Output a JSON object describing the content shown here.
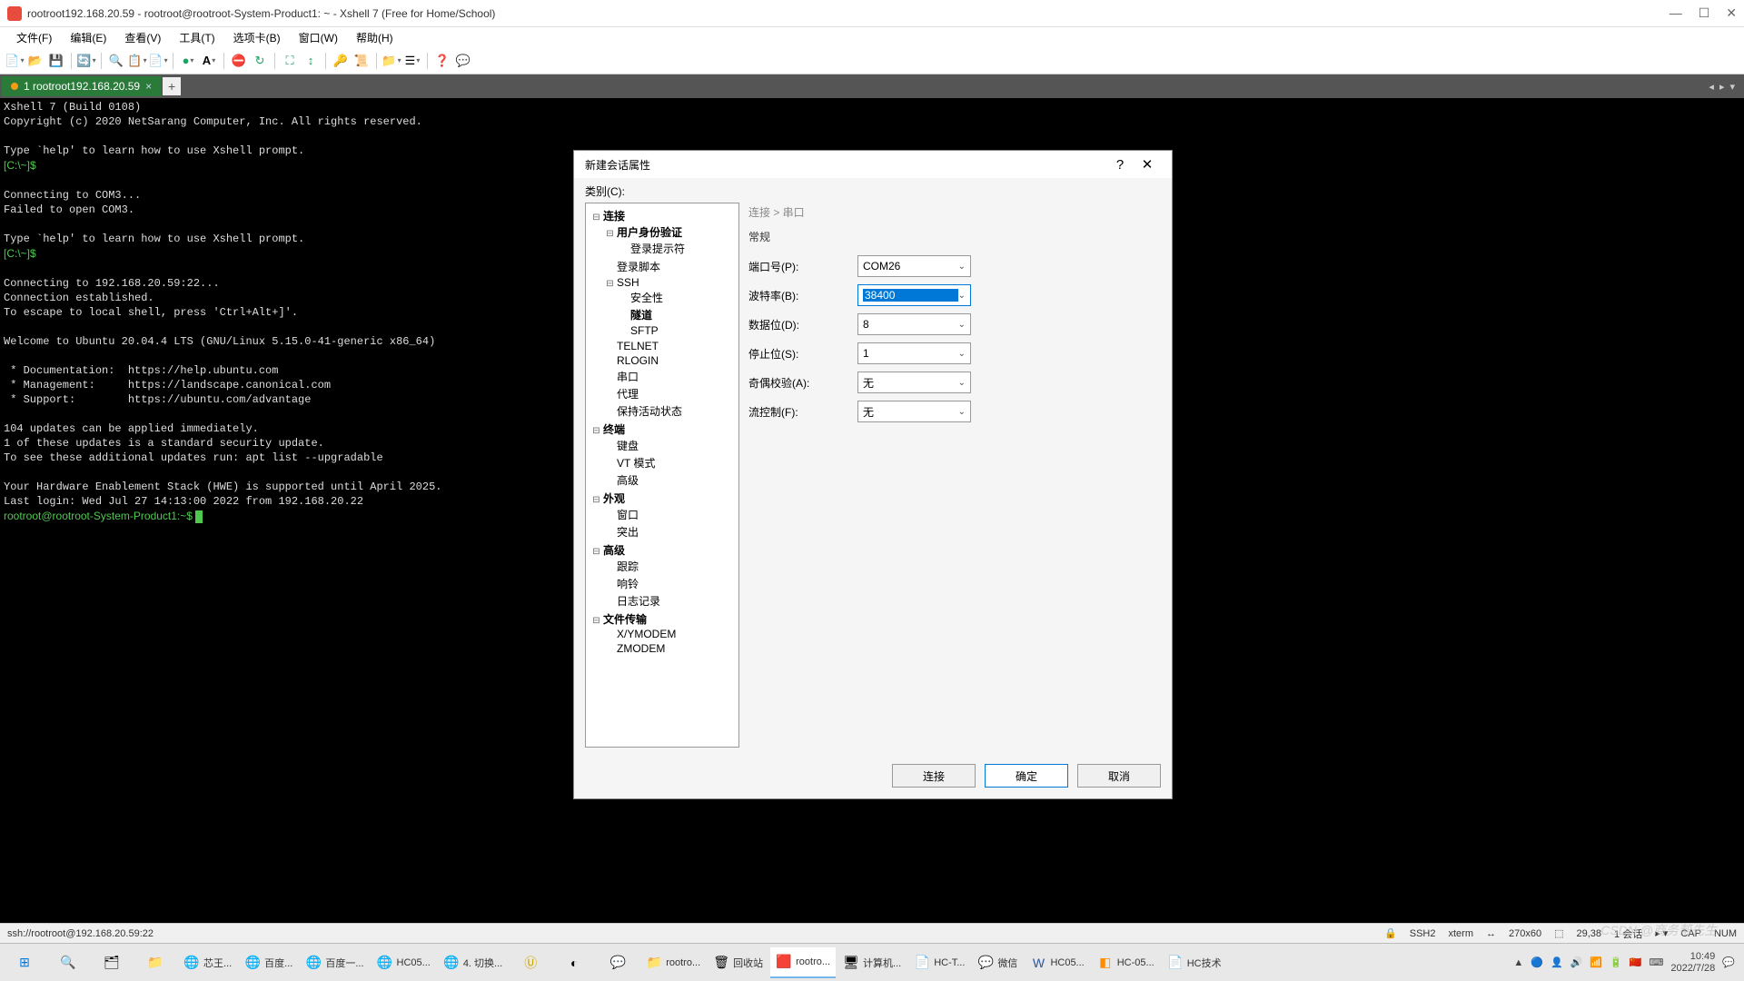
{
  "titlebar": {
    "text": "rootroot192.168.20.59 - rootroot@rootroot-System-Product1: ~ - Xshell 7 (Free for Home/School)"
  },
  "menubar": [
    "文件(F)",
    "编辑(E)",
    "查看(V)",
    "工具(T)",
    "选项卡(B)",
    "窗口(W)",
    "帮助(H)"
  ],
  "tab": {
    "label": "1 rootroot192.168.20.59"
  },
  "terminal": {
    "lines": [
      {
        "t": "Xshell 7 (Build 0108)",
        "cls": ""
      },
      {
        "t": "Copyright (c) 2020 NetSarang Computer, Inc. All rights reserved.",
        "cls": ""
      },
      {
        "t": "",
        "cls": ""
      },
      {
        "t": "Type `help' to learn how to use Xshell prompt.",
        "cls": ""
      },
      {
        "t": "[C:\\~]$",
        "cls": "term-green"
      },
      {
        "t": "",
        "cls": ""
      },
      {
        "t": "Connecting to COM3...",
        "cls": ""
      },
      {
        "t": "Failed to open COM3.",
        "cls": ""
      },
      {
        "t": "",
        "cls": ""
      },
      {
        "t": "Type `help' to learn how to use Xshell prompt.",
        "cls": ""
      },
      {
        "t": "[C:\\~]$",
        "cls": "term-green"
      },
      {
        "t": "",
        "cls": ""
      },
      {
        "t": "Connecting to 192.168.20.59:22...",
        "cls": ""
      },
      {
        "t": "Connection established.",
        "cls": ""
      },
      {
        "t": "To escape to local shell, press 'Ctrl+Alt+]'.",
        "cls": ""
      },
      {
        "t": "",
        "cls": ""
      },
      {
        "t": "Welcome to Ubuntu 20.04.4 LTS (GNU/Linux 5.15.0-41-generic x86_64)",
        "cls": ""
      },
      {
        "t": "",
        "cls": ""
      },
      {
        "t": " * Documentation:  https://help.ubuntu.com",
        "cls": ""
      },
      {
        "t": " * Management:     https://landscape.canonical.com",
        "cls": ""
      },
      {
        "t": " * Support:        https://ubuntu.com/advantage",
        "cls": ""
      },
      {
        "t": "",
        "cls": ""
      },
      {
        "t": "104 updates can be applied immediately.",
        "cls": ""
      },
      {
        "t": "1 of these updates is a standard security update.",
        "cls": ""
      },
      {
        "t": "To see these additional updates run: apt list --upgradable",
        "cls": ""
      },
      {
        "t": "",
        "cls": ""
      },
      {
        "t": "Your Hardware Enablement Stack (HWE) is supported until April 2025.",
        "cls": ""
      },
      {
        "t": "Last login: Wed Jul 27 14:13:00 2022 from 192.168.20.22",
        "cls": ""
      }
    ],
    "prompt": "rootroot@rootroot-System-Product1:~$ "
  },
  "dialog": {
    "title": "新建会话属性",
    "category_label": "类别(C):",
    "breadcrumb": "连接  >  串口",
    "section": "常规",
    "tree": {
      "connection": "连接",
      "auth": "用户身份验证",
      "login_prompt": "登录提示符",
      "login_script": "登录脚本",
      "ssh": "SSH",
      "security": "安全性",
      "tunnel": "隧道",
      "sftp": "SFTP",
      "telnet": "TELNET",
      "rlogin": "RLOGIN",
      "serial": "串口",
      "proxy": "代理",
      "keepalive": "保持活动状态",
      "terminal": "终端",
      "keyboard": "键盘",
      "vtmode": "VT 模式",
      "advanced_term": "高级",
      "appearance": "外观",
      "window": "窗口",
      "highlight": "突出",
      "advanced": "高级",
      "trace": "跟踪",
      "bell": "响铃",
      "logging": "日志记录",
      "file_transfer": "文件传输",
      "xymodem": "X/YMODEM",
      "zmodem": "ZMODEM"
    },
    "fields": {
      "port_label": "端口号(P):",
      "port_value": "COM26",
      "baud_label": "波特率(B):",
      "baud_value": "38400",
      "data_label": "数据位(D):",
      "data_value": "8",
      "stop_label": "停止位(S):",
      "stop_value": "1",
      "parity_label": "奇偶校验(A):",
      "parity_value": "无",
      "flow_label": "流控制(F):",
      "flow_value": "无"
    },
    "buttons": {
      "connect": "连接",
      "ok": "确定",
      "cancel": "取消"
    }
  },
  "statusbar": {
    "left": "ssh://rootroot@192.168.20.59:22",
    "ssh": "SSH2",
    "term": "xterm",
    "size": "270x60",
    "pos": "29,38",
    "sess": "1 会话",
    "cap": "CAP",
    "num": "NUM"
  },
  "taskbar": {
    "items": [
      {
        "label": "",
        "ico": "⊞",
        "color": "#0078d7"
      },
      {
        "label": "",
        "ico": "🔍"
      },
      {
        "label": "",
        "ico": "🗂"
      },
      {
        "label": "",
        "ico": "📁"
      },
      {
        "label": "芯王...",
        "ico": "🌐",
        "color": "#1ba160"
      },
      {
        "label": "百度...",
        "ico": "🌐",
        "color": "#1ba160"
      },
      {
        "label": "百度一...",
        "ico": "🌐",
        "color": "#1ba160"
      },
      {
        "label": "HC05...",
        "ico": "🌐",
        "color": "#1ba160"
      },
      {
        "label": "4. 切换...",
        "ico": "🌐",
        "color": "#1ba160"
      },
      {
        "label": "",
        "ico": "Ⓤ",
        "color": "#c9a500"
      },
      {
        "label": "",
        "ico": "◐"
      },
      {
        "label": "",
        "ico": "💬"
      },
      {
        "label": "rootro...",
        "ico": "📁"
      },
      {
        "label": "回收站",
        "ico": "🗑"
      },
      {
        "label": "rootro...",
        "ico": "🟥",
        "active": true
      },
      {
        "label": "计算机...",
        "ico": "🖥"
      },
      {
        "label": "HC-T...",
        "ico": "📄"
      },
      {
        "label": "微信",
        "ico": "💬",
        "color": "#07c160"
      },
      {
        "label": "HC05...",
        "ico": "W",
        "color": "#2b579a"
      },
      {
        "label": "HC-05...",
        "ico": "◧",
        "color": "#ff8c00"
      },
      {
        "label": "HC技术",
        "ico": "📄"
      }
    ],
    "tray_icons": [
      "▲",
      "🔵",
      "👤",
      "🔊",
      "📶",
      "🔋",
      "🇨🇳",
      "⌨"
    ],
    "time": "10:49",
    "date": "2022/7/28"
  },
  "watermark": "CSDN @商务帮先生"
}
